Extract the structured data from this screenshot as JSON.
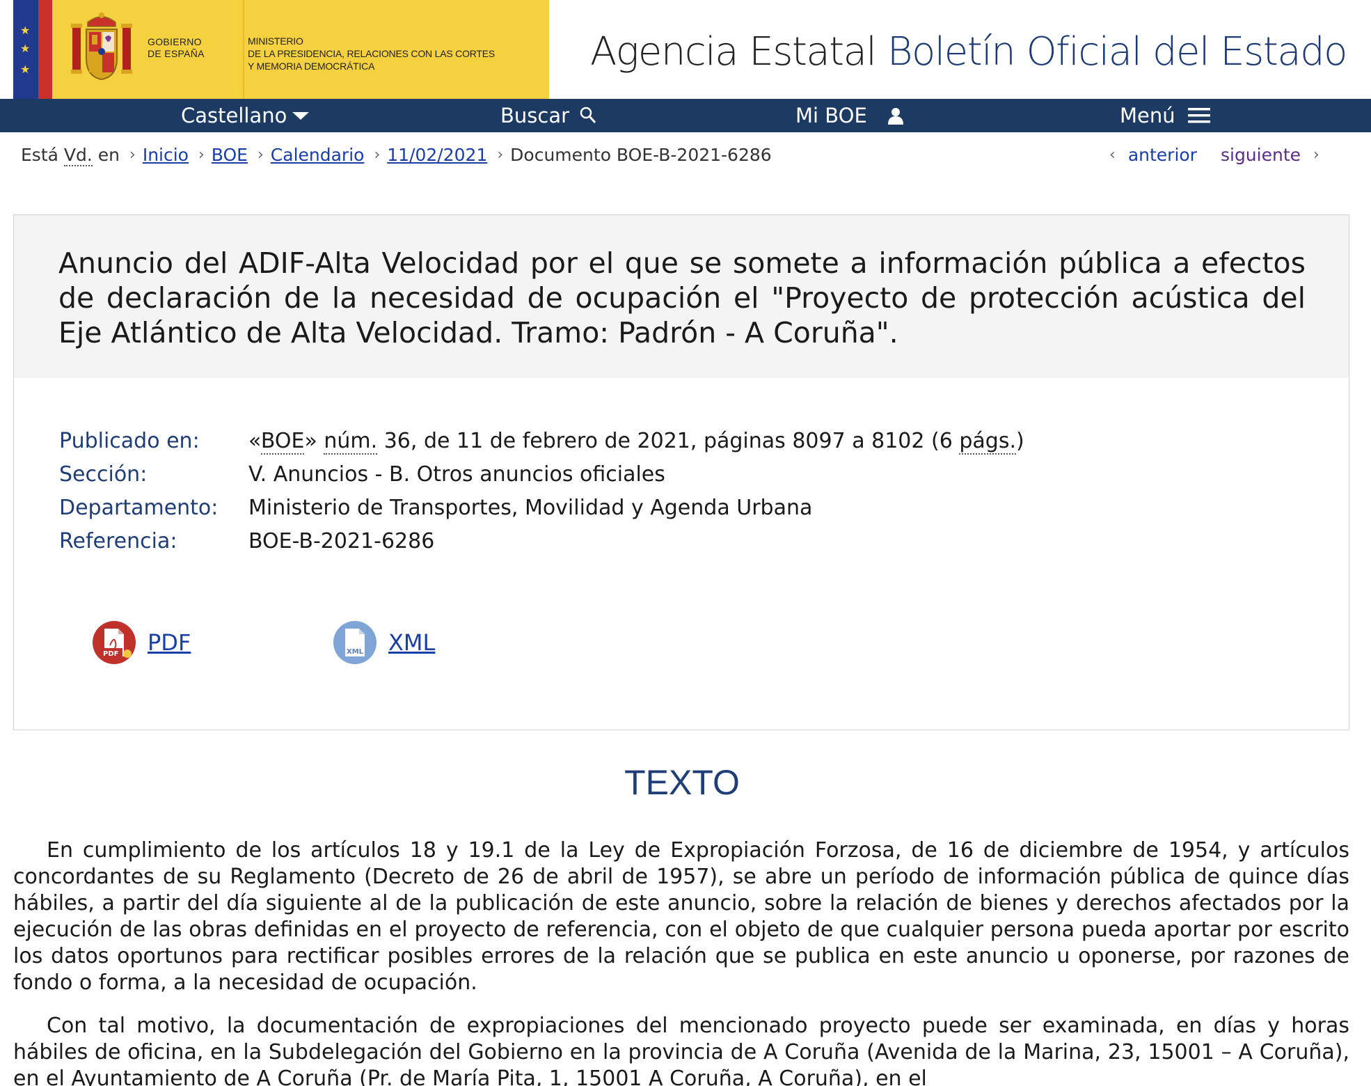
{
  "header": {
    "gov_line1": "Gobierno",
    "gov_line2": "de España",
    "ministry_line1": "Ministerio",
    "ministry_line2": "de la Presidencia, Relaciones con las Cortes",
    "ministry_line3": "y Memoria Democrática",
    "site_prefix": "Agencia Estatal",
    "site_name": "Boletín Oficial del Estado",
    "flag_colors": {
      "blue": "#213a8f",
      "red": "#c8312a",
      "yellow": "#f5d03f"
    }
  },
  "nav": {
    "language": "Castellano",
    "search": "Buscar",
    "my_boe": "Mi BOE",
    "menu": "Menú"
  },
  "breadcrumb": {
    "prefix_1": "Está",
    "prefix_vd": "Vd.",
    "prefix_2": "en",
    "items": [
      "Inicio",
      "BOE",
      "Calendario",
      "11/02/2021"
    ],
    "current": "Documento BOE-B-2021-6286"
  },
  "pager": {
    "previous": "anterior",
    "next": "siguiente"
  },
  "document": {
    "title": "Anuncio del ADIF-Alta Velocidad por el que se somete a información pública a efectos de declaración de la necesidad de ocupación el \"Proyecto de protección acústica del Eje Atlántico de Alta Velocidad. Tramo: Padrón - A Coruña\".",
    "meta": {
      "published_label": "Publicado en:",
      "published_open": "«",
      "published_boe": "BOE",
      "published_close": "»",
      "published_num": "núm.",
      "published_rest": "36, de 11 de febrero de 2021, páginas 8097 a 8102 (6",
      "published_pags": "págs.",
      "published_end": ")",
      "section_label": "Sección:",
      "section_value": "V. Anuncios - B. Otros anuncios oficiales",
      "department_label": "Departamento:",
      "department_value": "Ministerio de Transportes, Movilidad y Agenda Urbana",
      "reference_label": "Referencia:",
      "reference_value": "BOE-B-2021-6286"
    },
    "downloads": {
      "pdf": "PDF",
      "xml": "XML",
      "pdf_icon_text": "PDF",
      "xml_icon_text": "XML"
    }
  },
  "texto": {
    "heading": "TEXTO",
    "paragraphs": [
      "En cumplimiento de los artículos 18 y 19.1 de la Ley de Expropiación Forzosa, de 16 de diciembre de 1954, y artículos concordantes de su Reglamento (Decreto de 26 de abril de 1957), se abre un período de información pública de quince días hábiles, a partir del día siguiente al de la publicación de este anuncio, sobre la relación de bienes y derechos afectados por la ejecución de las obras definidas en el proyecto de referencia, con el objeto de que cualquier persona pueda aportar por escrito los datos oportunos para rectificar posibles errores de la relación que se publica en este anuncio u oponerse, por razones de fondo o forma, a la necesidad de ocupación.",
      "Con tal motivo, la documentación de expropiaciones del mencionado proyecto puede ser examinada, en días y horas hábiles de oficina, en la Subdelegación del Gobierno en la provincia de A Coruña (Avenida de la Marina, 23, 15001 – A Coruña), en el Ayuntamiento de A Coruña (Pr. de María Pita, 1, 15001 A Coruña, A Coruña), en el"
    ]
  }
}
